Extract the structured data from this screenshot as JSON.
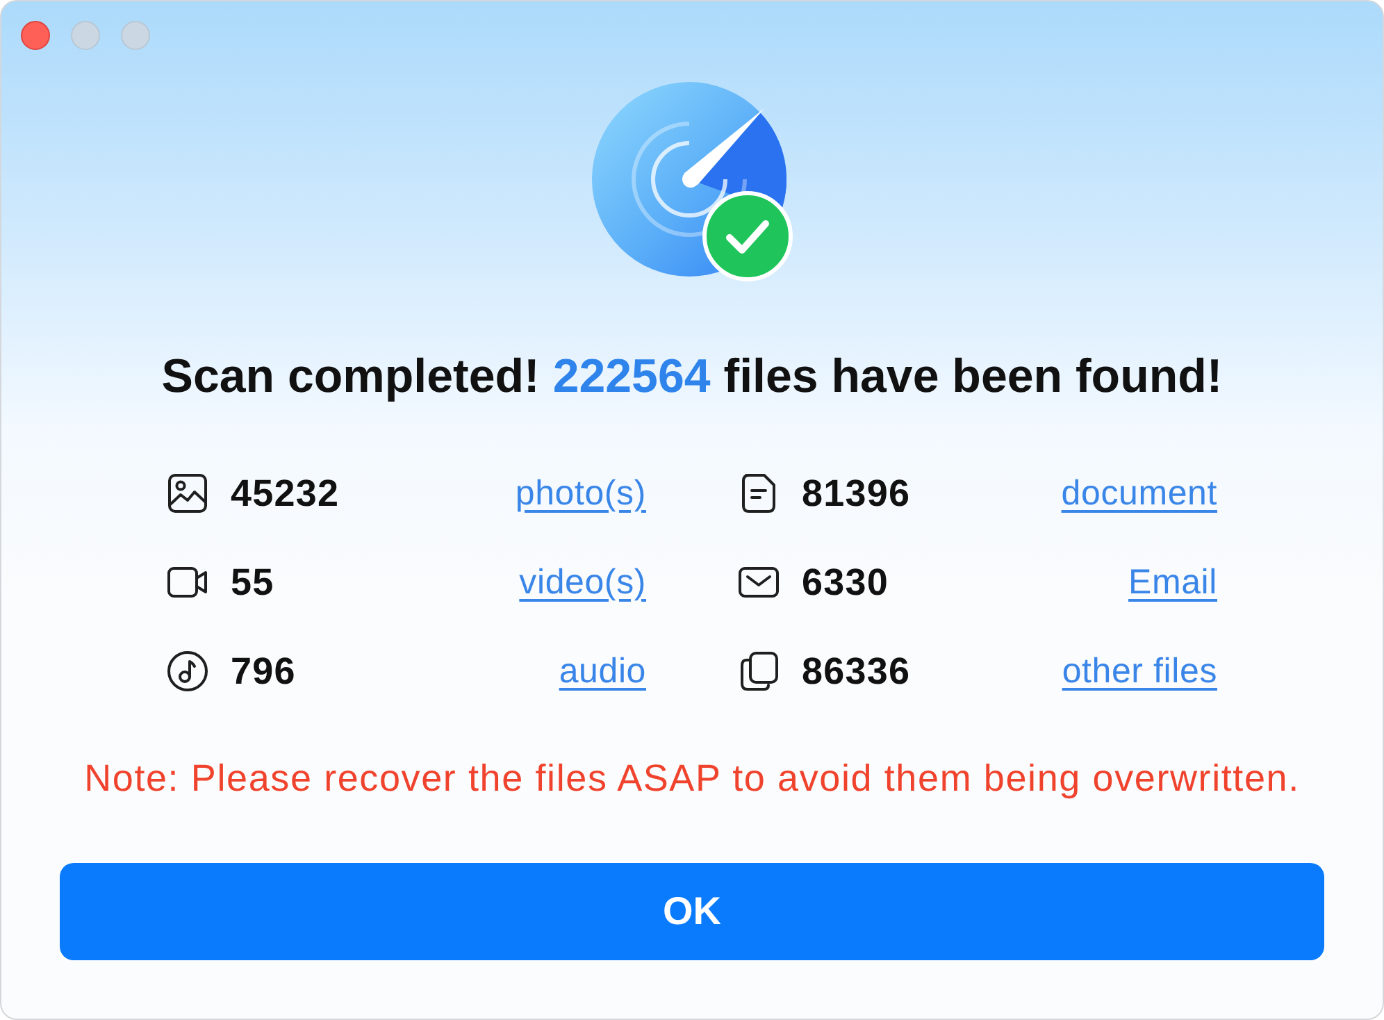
{
  "window": {
    "controls": [
      {
        "kind": "close",
        "disabled": false
      },
      {
        "kind": "minimize",
        "disabled": true
      },
      {
        "kind": "zoom",
        "disabled": true
      }
    ]
  },
  "result": {
    "heading_before": "Scan completed!",
    "total": "222564",
    "heading_after": "files have been found!"
  },
  "categories": [
    {
      "kind": "photo",
      "count": "45232",
      "label": "photo(s)"
    },
    {
      "kind": "document",
      "count": "81396",
      "label": "document"
    },
    {
      "kind": "video",
      "count": "55",
      "label": "video(s)"
    },
    {
      "kind": "email",
      "count": "6330",
      "label": "Email"
    },
    {
      "kind": "audio",
      "count": "796",
      "label": "audio"
    },
    {
      "kind": "other",
      "count": "86336",
      "label": "other files"
    }
  ],
  "note": "Note: Please recover the files ASAP to avoid them being overwritten.",
  "buttons": [
    "OK"
  ]
}
